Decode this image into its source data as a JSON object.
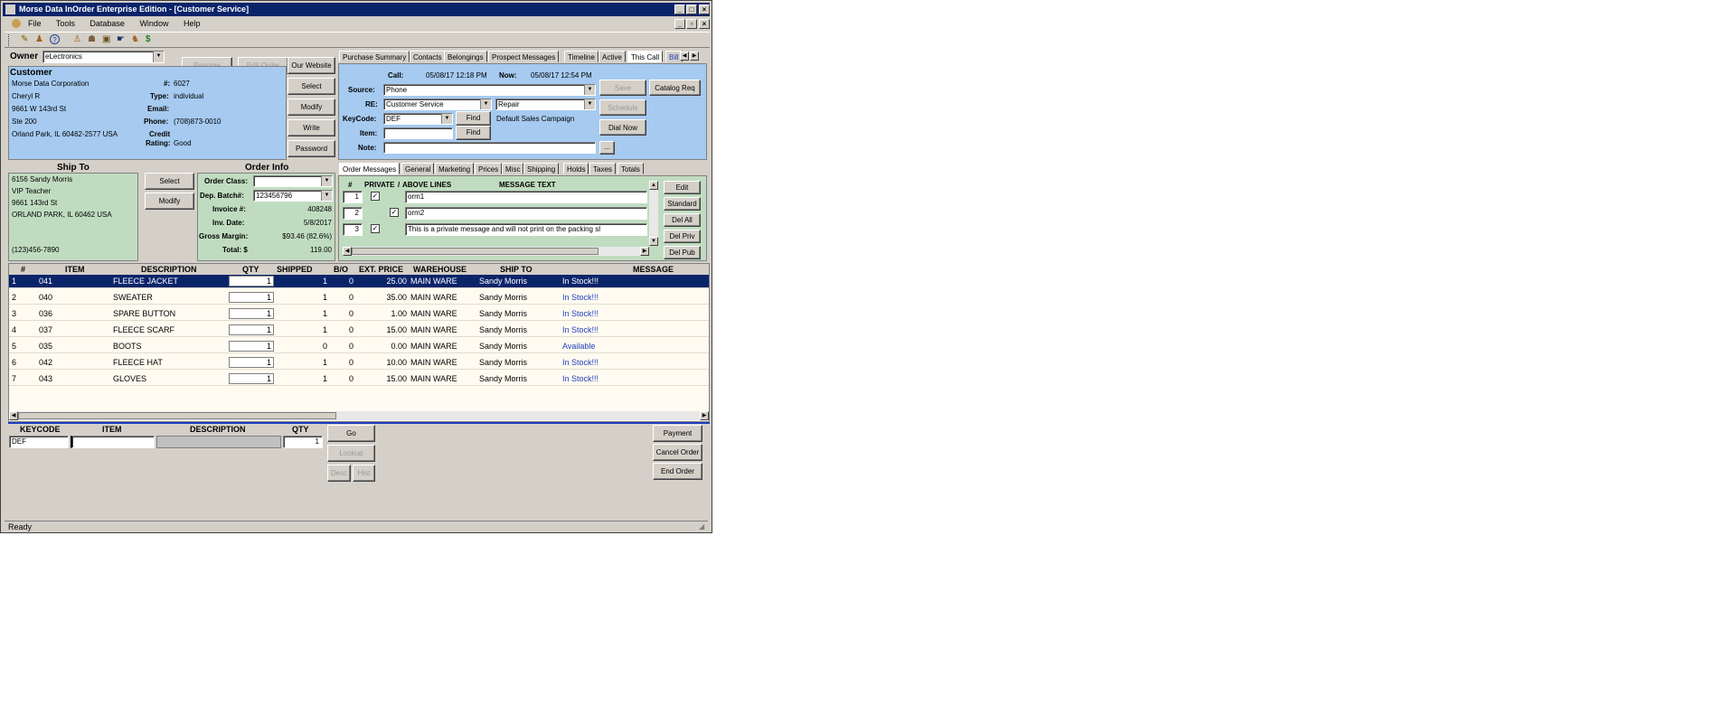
{
  "window": {
    "title": "Morse Data InOrder Enterprise Edition - [Customer Service]",
    "controls": {
      "minimize": "_",
      "maximize": "□",
      "close": "×"
    }
  },
  "menu": [
    "File",
    "Tools",
    "Database",
    "Window",
    "Help"
  ],
  "owner": {
    "label": "Owner",
    "value": "eLectronics"
  },
  "customer": {
    "label": "Customer",
    "company": "Morse Data Corporation",
    "contact": "Cheryl R",
    "address1": "9661 W 143rd St",
    "address2": "Ste 200",
    "city_line": "Orland Park, IL  60462-2577   USA",
    "number_label": "#:",
    "number": "6027",
    "type_label": "Type:",
    "type": "individual",
    "email_label": "Email:",
    "email": "",
    "phone_label": "Phone:",
    "phone": "(708)873-0010",
    "credit_label": "Credit",
    "rating_label": "Rating:",
    "rating": "Good"
  },
  "customer_buttons": {
    "resume": "Resume",
    "edit_order": "Edit Order",
    "our_website": "Our Website",
    "select": "Select",
    "modify": "Modify",
    "write": "Write",
    "password": "Password"
  },
  "top_tabs": [
    "Purchase Summary",
    "Contacts",
    "Belongings",
    "Prospect Messages",
    "Timeline",
    "Active",
    "This Call",
    "Bill"
  ],
  "call": {
    "call_label": "Call:",
    "call_time": "05/08/17 12:18 PM",
    "now_label": "Now:",
    "now_time": "05/08/17 12:54 PM",
    "source_label": "Source:",
    "source": "Phone",
    "re_label": "RE:",
    "re": "Customer Service",
    "re2": "Repair",
    "keycode_label": "KeyCode:",
    "keycode": "DEF",
    "find": "Find",
    "campaign": "Default Sales Campaign",
    "item_label": "Item:",
    "item": "",
    "note_label": "Note:",
    "note": "",
    "ellipsis": "...",
    "save": "Save",
    "catalog_req": "Catalog Req",
    "schedule": "Schedule",
    "dial_now": "Dial Now"
  },
  "ship_to": {
    "label": "Ship To",
    "lines": [
      "6156 Sandy Morris",
      "VIP Teacher",
      "9661 143rd St",
      "ORLAND PARK, IL  60462   USA",
      "",
      "",
      "(123)456-7890"
    ],
    "select": "Select",
    "modify": "Modify"
  },
  "order_info": {
    "label": "Order Info",
    "order_class_label": "Order Class:",
    "order_class": "",
    "dep_batch_label": "Dep. Batch#:",
    "dep_batch": "123456796",
    "invoice_label": "Invoice #:",
    "invoice": "408248",
    "inv_date_label": "Inv. Date:",
    "inv_date": "5/8/2017",
    "gross_margin_label": "Gross Margin:",
    "gross_margin": "$93.46 (82.6%)",
    "total_label": "Total: $",
    "total": "119.00"
  },
  "msg_tabs": [
    "Order Messages",
    "General",
    "Marketing",
    "Prices",
    "Misc",
    "Shipping",
    "Holds",
    "Taxes",
    "Totals"
  ],
  "messages": {
    "headers": [
      "#",
      "PRIVATE",
      "ABOVE LINES",
      "MESSAGE TEXT"
    ],
    "rows": [
      {
        "num": "1",
        "private": true,
        "above": false,
        "text": "orm1"
      },
      {
        "num": "2",
        "private": false,
        "above": true,
        "text": "orm2"
      },
      {
        "num": "3",
        "private": true,
        "above": false,
        "text": "This is a private message and will not print on the packing sl"
      }
    ],
    "buttons": {
      "edit": "Edit",
      "standard": "Standard",
      "del_all": "Del All",
      "del_priv": "Del Priv",
      "del_pub": "Del Pub"
    }
  },
  "lines": {
    "headers": [
      "#",
      "ITEM",
      "DESCRIPTION",
      "QTY",
      "SHIPPED",
      "B/O",
      "EXT. PRICE",
      "WAREHOUSE",
      "SHIP TO",
      "MESSAGE"
    ],
    "rows": [
      {
        "num": "1",
        "item": "041",
        "desc": "FLEECE JACKET",
        "qty": "1",
        "shipped": "1",
        "bo": "0",
        "price": "25.00",
        "wh": "MAIN WARE",
        "shipto": "Sandy Morris",
        "msg": "In Stock!!!"
      },
      {
        "num": "2",
        "item": "040",
        "desc": "SWEATER",
        "qty": "1",
        "shipped": "1",
        "bo": "0",
        "price": "35.00",
        "wh": "MAIN WARE",
        "shipto": "Sandy Morris",
        "msg": "In Stock!!!"
      },
      {
        "num": "3",
        "item": "036",
        "desc": "SPARE BUTTON",
        "qty": "1",
        "shipped": "1",
        "bo": "0",
        "price": "1.00",
        "wh": "MAIN WARE",
        "shipto": "Sandy Morris",
        "msg": "In Stock!!!"
      },
      {
        "num": "4",
        "item": "037",
        "desc": "FLEECE SCARF",
        "qty": "1",
        "shipped": "1",
        "bo": "0",
        "price": "15.00",
        "wh": "MAIN WARE",
        "shipto": "Sandy Morris",
        "msg": "In Stock!!!"
      },
      {
        "num": "5",
        "item": "035",
        "desc": "BOOTS",
        "qty": "1",
        "shipped": "0",
        "bo": "0",
        "price": "0.00",
        "wh": "MAIN WARE",
        "shipto": "Sandy Morris",
        "msg": "Available"
      },
      {
        "num": "6",
        "item": "042",
        "desc": "FLEECE HAT",
        "qty": "1",
        "shipped": "1",
        "bo": "0",
        "price": "10.00",
        "wh": "MAIN WARE",
        "shipto": "Sandy Morris",
        "msg": "In Stock!!!"
      },
      {
        "num": "7",
        "item": "043",
        "desc": "GLOVES",
        "qty": "1",
        "shipped": "1",
        "bo": "0",
        "price": "15.00",
        "wh": "MAIN WARE",
        "shipto": "Sandy Morris",
        "msg": "In Stock!!!"
      }
    ]
  },
  "entry": {
    "headers": [
      "KEYCODE",
      "ITEM",
      "DESCRIPTION",
      "QTY"
    ],
    "keycode": "DEF",
    "item": "",
    "description": "",
    "qty": "1",
    "go": "Go",
    "lookup": "Lookup",
    "desc_btn": "Desc",
    "hist_btn": "Hist",
    "payment": "Payment",
    "cancel_order": "Cancel Order",
    "end_order": "End Order"
  },
  "status": {
    "text": "Ready"
  },
  "colors": {
    "title_bar": "#0a246a",
    "customer_panel": "#a6caf0",
    "ship_panel": "#c0dcc0",
    "selected_row": "#0a246a",
    "message_link": "#1f3fbf"
  }
}
